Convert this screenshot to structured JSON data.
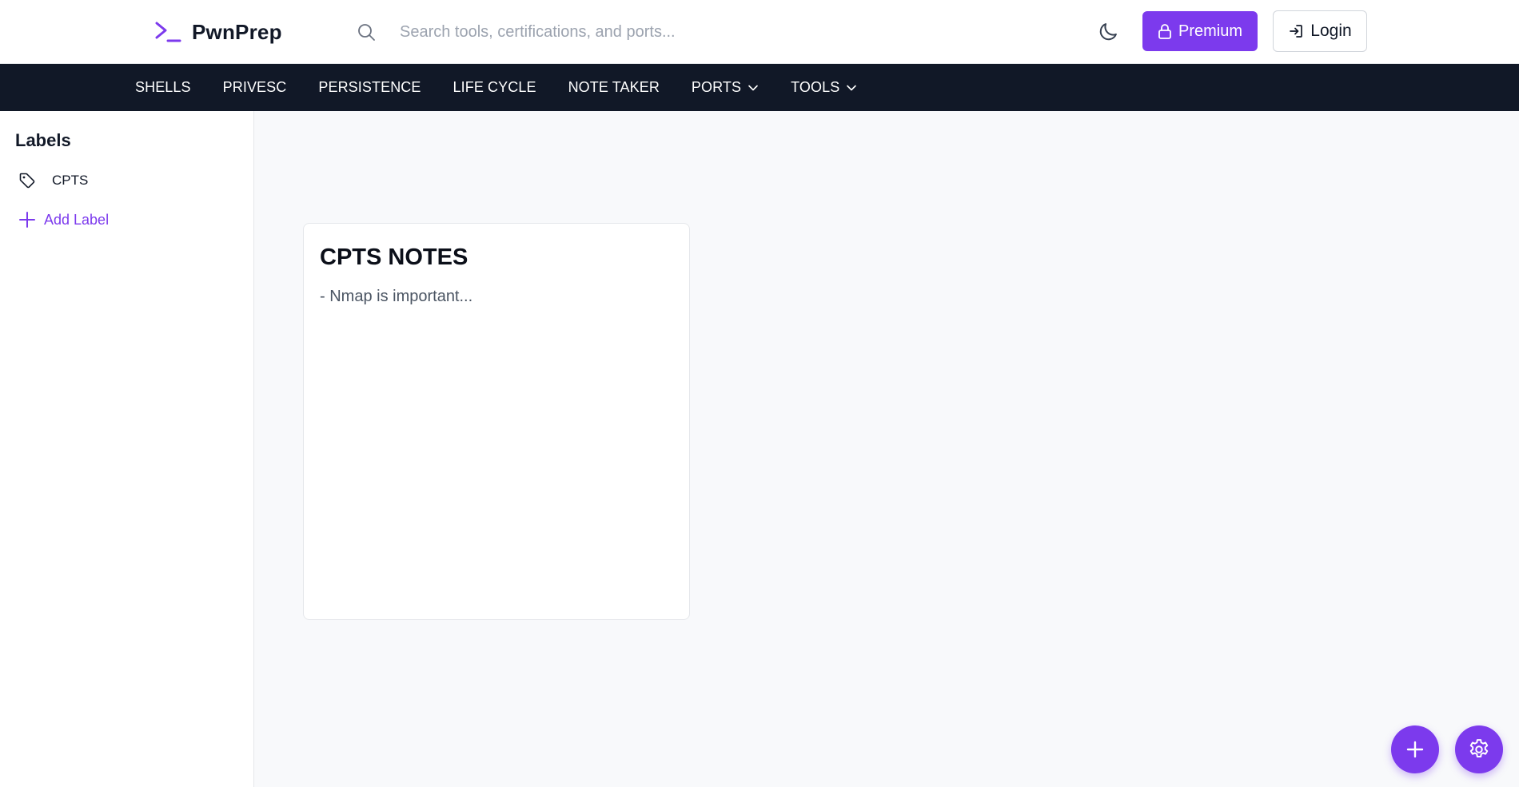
{
  "header": {
    "brand": "PwnPrep",
    "search_placeholder": "Search tools, certifications, and ports...",
    "premium_label": "Premium",
    "login_label": "Login"
  },
  "nav": {
    "items": [
      {
        "label": "SHELLS"
      },
      {
        "label": "PRIVESC"
      },
      {
        "label": "PERSISTENCE"
      },
      {
        "label": "LIFE CYCLE"
      },
      {
        "label": "NOTE TAKER"
      },
      {
        "label": "PORTS"
      },
      {
        "label": "TOOLS"
      }
    ]
  },
  "sidebar": {
    "title": "Labels",
    "labels": [
      {
        "name": "CPTS"
      }
    ],
    "add_label": "Add Label"
  },
  "notes": [
    {
      "title": "CPTS NOTES",
      "body": "- Nmap is important..."
    }
  ],
  "colors": {
    "accent": "#7c3aed",
    "nav_bg": "#111827",
    "page_bg": "#f8f9fb"
  },
  "icons": {
    "brand": "terminal-prompt-icon",
    "search": "search-icon",
    "theme": "moon-icon",
    "premium": "lock-icon",
    "login": "login-icon",
    "dropdown": "chevron-down-icon",
    "label": "tag-icon",
    "add": "plus-icon",
    "settings": "gear-icon"
  }
}
